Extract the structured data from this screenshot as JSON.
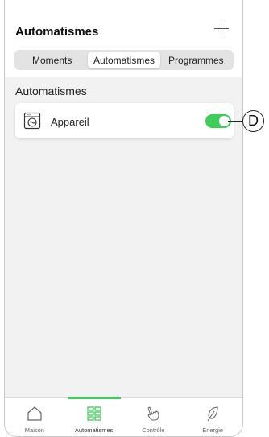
{
  "header": {
    "title": "Automatismes"
  },
  "segments": [
    {
      "label": "Moments"
    },
    {
      "label": "Automatismes"
    },
    {
      "label": "Programmes"
    }
  ],
  "section": {
    "title": "Automatismes"
  },
  "card": {
    "label": "Appareil",
    "toggle_on": true
  },
  "callout": {
    "letter": "D"
  },
  "tabs": [
    {
      "label": "Maison",
      "icon": "house-icon"
    },
    {
      "label": "Automatismes",
      "icon": "grid-icon"
    },
    {
      "label": "Contrôle",
      "icon": "hand-icon"
    },
    {
      "label": "Énergie",
      "icon": "leaf-icon"
    }
  ],
  "colors": {
    "accent": "#3dcd58"
  }
}
